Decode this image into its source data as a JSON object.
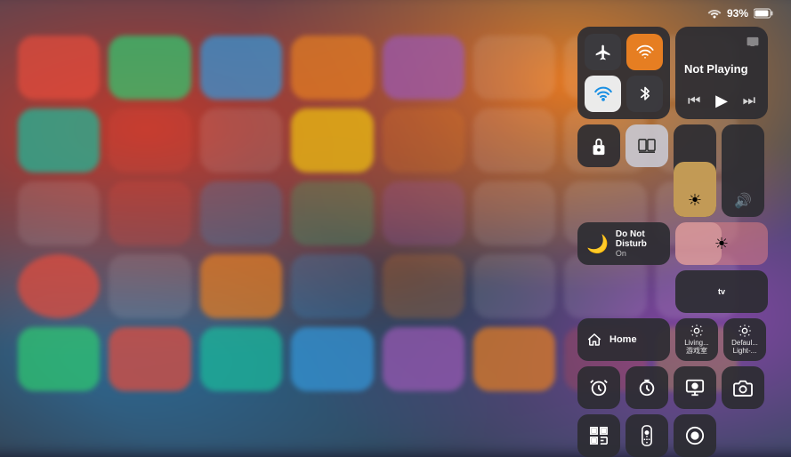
{
  "status_bar": {
    "wifi": "wifi-icon",
    "battery_percent": "93%",
    "battery_icon": "battery-icon"
  },
  "control_center": {
    "connectivity": {
      "airplane": {
        "icon": "✈",
        "active": false
      },
      "cellular": {
        "icon": "📡",
        "active": true
      },
      "wifi": {
        "icon": "wifi",
        "active": true
      },
      "bluetooth": {
        "icon": "bluetooth",
        "active": false
      }
    },
    "now_playing": {
      "title": "Not Playing",
      "airplay_icon": "airplay",
      "prev": "⏮",
      "play": "▶",
      "next": "⏭"
    },
    "screen_lock": {
      "icon": "lock"
    },
    "mirror": {
      "icon": "mirror"
    },
    "brightness_slider": {
      "value": 60,
      "icon": "☀"
    },
    "volume_slider": {
      "value": 0,
      "icon": "🔊"
    },
    "do_not_disturb": {
      "title": "Do Not Disturb",
      "subtitle": "On"
    },
    "apple_tv": {
      "label": "tv"
    },
    "home": {
      "icon": "home",
      "label": "Home"
    },
    "living_room": {
      "icon": "💡",
      "label": "Living...\n游戏室"
    },
    "default_light": {
      "icon": "💡",
      "label": "Defaul...\nLight-..."
    },
    "alarm": {
      "icon": "🔔"
    },
    "timer": {
      "icon": "⏱"
    },
    "screen_record": {
      "icon": "⏺"
    },
    "camera": {
      "icon": "📷"
    },
    "qr_scanner": {
      "icon": "⊞"
    },
    "remote": {
      "icon": "remote"
    },
    "record2": {
      "icon": "⊙"
    }
  }
}
